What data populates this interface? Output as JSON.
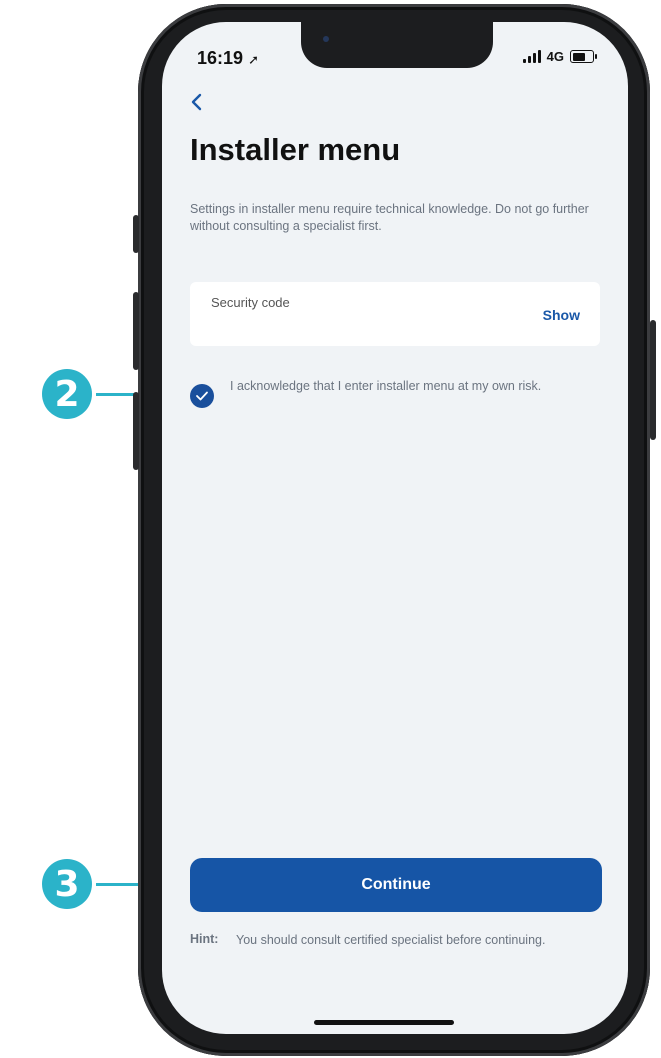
{
  "status_bar": {
    "time": "16:19",
    "network": "4G"
  },
  "page": {
    "title": "Installer menu",
    "description": "Settings in installer menu require technical knowledge. Do not go further without consulting a specialist first."
  },
  "security_field": {
    "label": "Security code",
    "show_label": "Show"
  },
  "acknowledge": {
    "checked": true,
    "text": "I acknowledge that I enter installer menu at my own risk."
  },
  "continue_label": "Continue",
  "hint": {
    "label": "Hint:",
    "text": "You should consult certified specialist before continuing."
  },
  "markers": [
    {
      "number": "2"
    },
    {
      "number": "3"
    }
  ],
  "colors": {
    "accent": "#1655a6",
    "marker": "#2bb3c9",
    "background": "#f0f3f6"
  }
}
